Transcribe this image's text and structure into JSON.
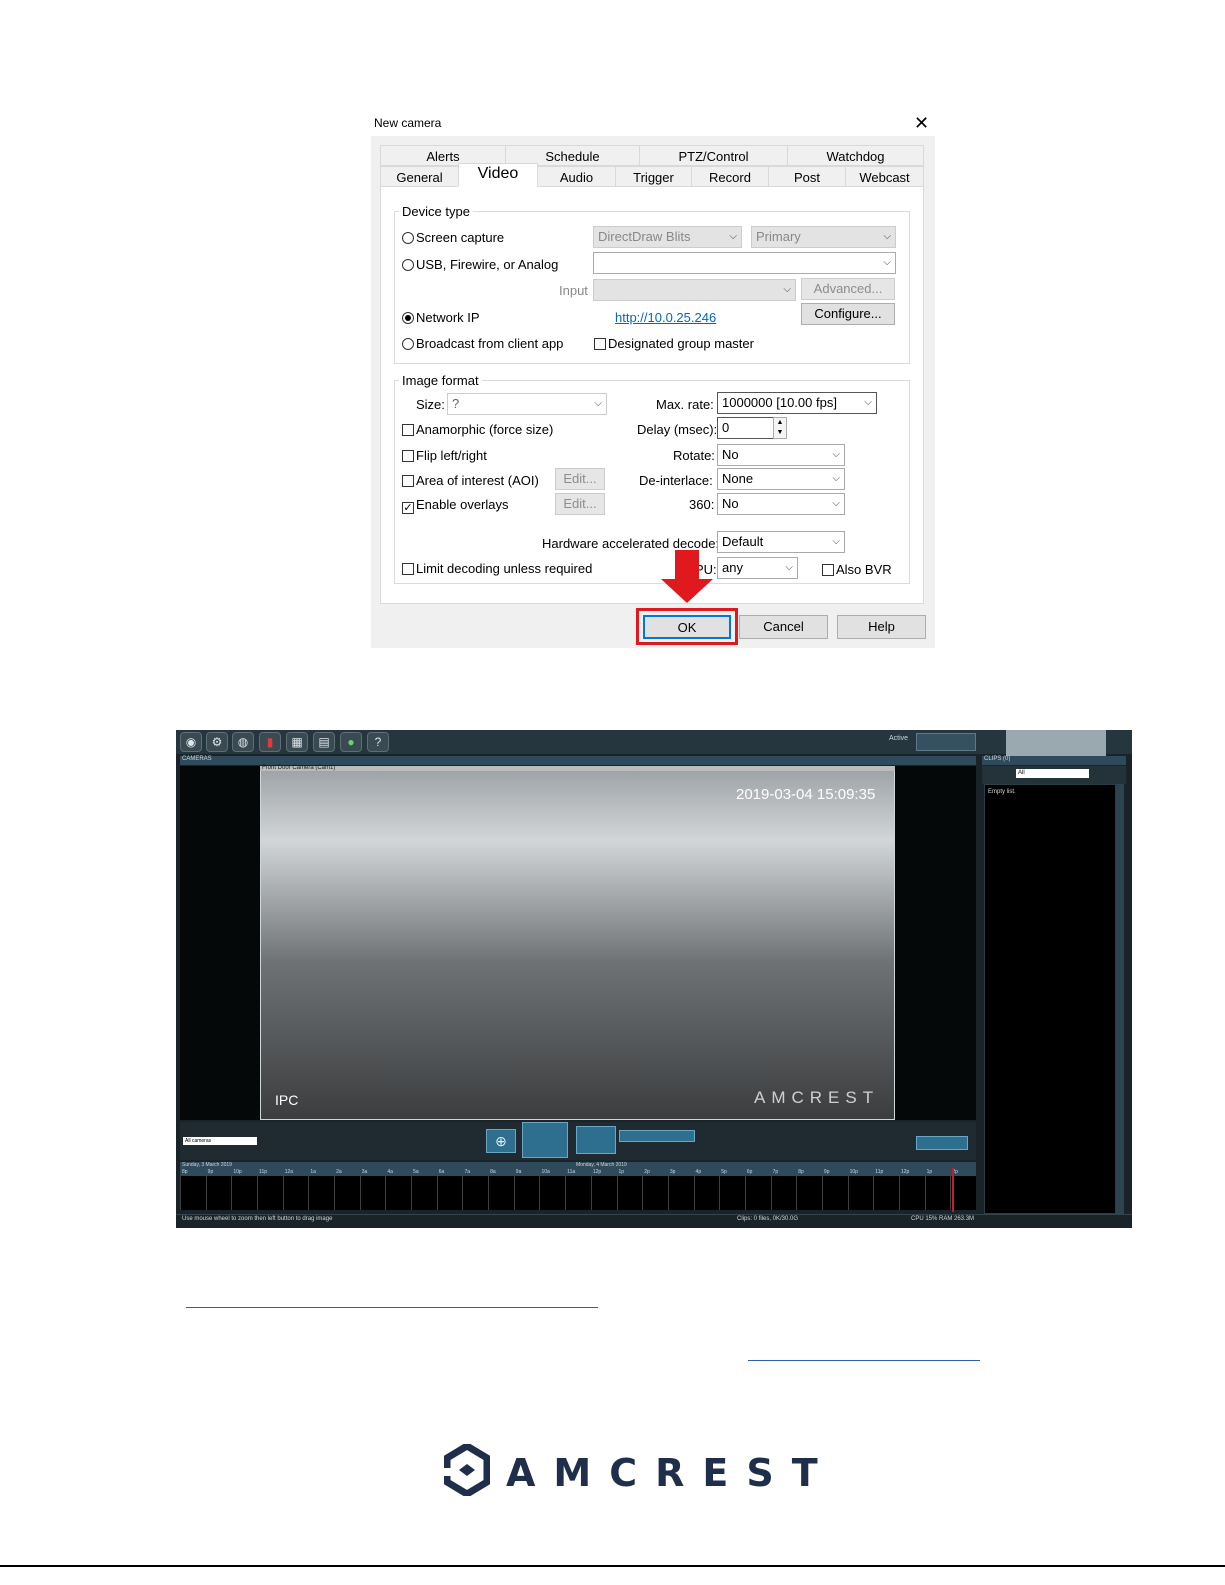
{
  "dialog": {
    "title": "New camera",
    "tabs_row1": [
      "Alerts",
      "Schedule",
      "PTZ/Control",
      "Watchdog"
    ],
    "tabs_row2": [
      "General",
      "Video",
      "Audio",
      "Trigger",
      "Record",
      "Post",
      "Webcast"
    ],
    "active_tab": "Video",
    "device_type": {
      "legend": "Device type",
      "screen_capture": "Screen capture",
      "screen_combo1": "DirectDraw Blits",
      "screen_combo2": "Primary",
      "usb": "USB, Firewire, or Analog",
      "input_label": "Input",
      "advanced_button": "Advanced...",
      "network_ip": "Network IP",
      "url": "http://10.0.25.246",
      "configure_button": "Configure...",
      "broadcast": "Broadcast from client app",
      "designated": "Designated group master"
    },
    "image_format": {
      "legend": "Image format",
      "size_label": "Size:",
      "size_value": "?",
      "max_rate_label": "Max. rate:",
      "max_rate_value": "1000000 [10.00 fps]",
      "anamorphic": "Anamorphic (force size)",
      "delay_label": "Delay (msec):",
      "delay_value": "0",
      "flip": "Flip left/right",
      "rotate_label": "Rotate:",
      "rotate_value": "No",
      "aoi": "Area of interest (AOI)",
      "edit_button": "Edit...",
      "deinterlace_label": "De-interlace:",
      "deinterlace_value": "None",
      "overlays": "Enable overlays",
      "deg360_label": "360:",
      "deg360_value": "No",
      "hw_label": "Hardware accelerated decode:",
      "hw_value": "Default",
      "limit": "Limit decoding unless required",
      "gpu_label": "PU:",
      "gpu_value": "any",
      "also_bvr": "Also BVR"
    },
    "ok_button": "OK",
    "cancel_button": "Cancel",
    "help_button": "Help",
    "highlight_color": "#e0191f"
  },
  "blueiris": {
    "status": "Active",
    "cameras_header": "CAMERAS",
    "camera_title": "Front Door Camera (Cam1)",
    "timestamp": "2019-03-04 15:09:35",
    "osd_left": "IPC",
    "osd_brand": "AMCREST",
    "clips_header": "CLIPS  (0)",
    "clips_filter": "All",
    "clips_empty": "Empty list.",
    "group_select": "All cameras",
    "timeline_day1": "Sunday, 3 March 2019",
    "timeline_day2": "Monday, 4 March 2019",
    "timeline_hours": [
      "8p",
      "9p",
      "10p",
      "11p",
      "12a",
      "1a",
      "2a",
      "3a",
      "4a",
      "5a",
      "6a",
      "7a",
      "8a",
      "9a",
      "10a",
      "11a",
      "12p",
      "1p",
      "2p",
      "3p",
      "4p",
      "5p",
      "6p",
      "7p",
      "8p",
      "9p",
      "10p",
      "11p",
      "12p",
      "1p",
      "2p"
    ],
    "status_left": "Use mouse wheel to zoom then left button to drag image",
    "status_clips": "Clips: 0 files, 0K/30.0G",
    "status_cpu": "CPU 15% RAM 263.3M"
  },
  "footer": {
    "brand": "AMCREST",
    "brand_color": "#1f2e4a"
  }
}
